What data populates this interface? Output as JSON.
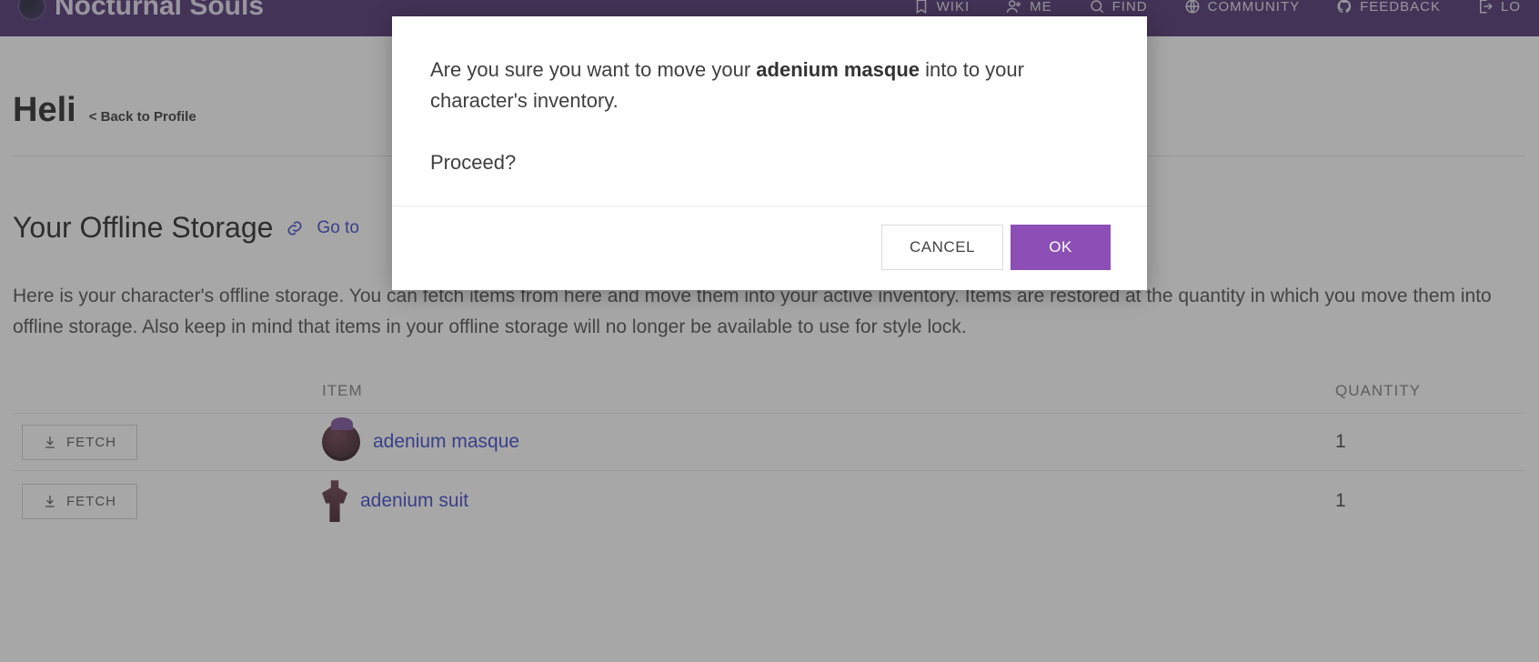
{
  "brand": {
    "name": "Nocturnal Souls"
  },
  "nav": {
    "wiki": "WIKI",
    "me": "ME",
    "find": "FIND",
    "community": "COMMUNITY",
    "feedback": "FEEDBACK",
    "logout_prefix": "LO"
  },
  "character": {
    "name": "Heli",
    "back_link": "< Back to Profile"
  },
  "storage": {
    "title": "Your Offline Storage",
    "goto_link_prefix": "Go to",
    "description": "Here is your character's offline storage. You can fetch items from here and move them into your active inventory. Items are restored at the quantity in which you move them into offline storage. Also keep in mind that items in your offline storage will no longer be available to use for style lock.",
    "columns": {
      "action": "",
      "item": "ITEM",
      "quantity": "QUANTITY"
    },
    "fetch_label": "FETCH",
    "items": [
      {
        "name": "adenium masque",
        "quantity": "1",
        "icon": "masque"
      },
      {
        "name": "adenium suit",
        "quantity": "1",
        "icon": "suit"
      }
    ]
  },
  "modal": {
    "msg_prefix": "Are you sure you want to move your ",
    "item_name": "adenium masque",
    "msg_suffix": " into to your character's inventory.",
    "proceed": "Proceed?",
    "cancel": "CANCEL",
    "ok": "OK"
  }
}
